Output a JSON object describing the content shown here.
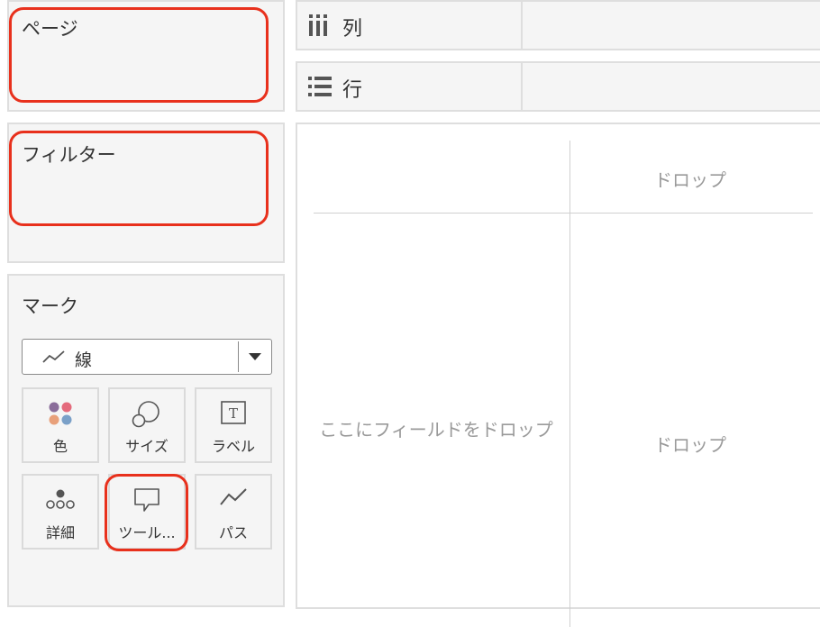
{
  "pages_panel": {
    "title": "ページ"
  },
  "filters_panel": {
    "title": "フィルター"
  },
  "marks_panel": {
    "title": "マーク",
    "mark_type": {
      "icon": "line-chart-icon",
      "label": "線"
    },
    "buttons": [
      {
        "label": "色",
        "icon": "color-dots-icon"
      },
      {
        "label": "サイズ",
        "icon": "size-circles-icon"
      },
      {
        "label": "ラベル",
        "icon": "text-label-icon"
      },
      {
        "label": "詳細",
        "icon": "detail-dots-icon"
      },
      {
        "label": "ツール...",
        "icon": "tooltip-icon"
      },
      {
        "label": "パス",
        "icon": "path-line-icon"
      }
    ]
  },
  "shelves": {
    "columns": {
      "label": "列",
      "icon": "columns-icon"
    },
    "rows": {
      "label": "行",
      "icon": "rows-icon"
    }
  },
  "canvas": {
    "drop_top": "ドロップ",
    "drop_left": "ここにフィールドをドロップ",
    "drop_center": "ドロップ"
  },
  "colors": {
    "highlight": "#e8301c",
    "dot_purple": "#8a6d9a",
    "dot_pink": "#e46a7c",
    "dot_orange": "#e8a07a",
    "dot_blue": "#7aa0c8"
  }
}
